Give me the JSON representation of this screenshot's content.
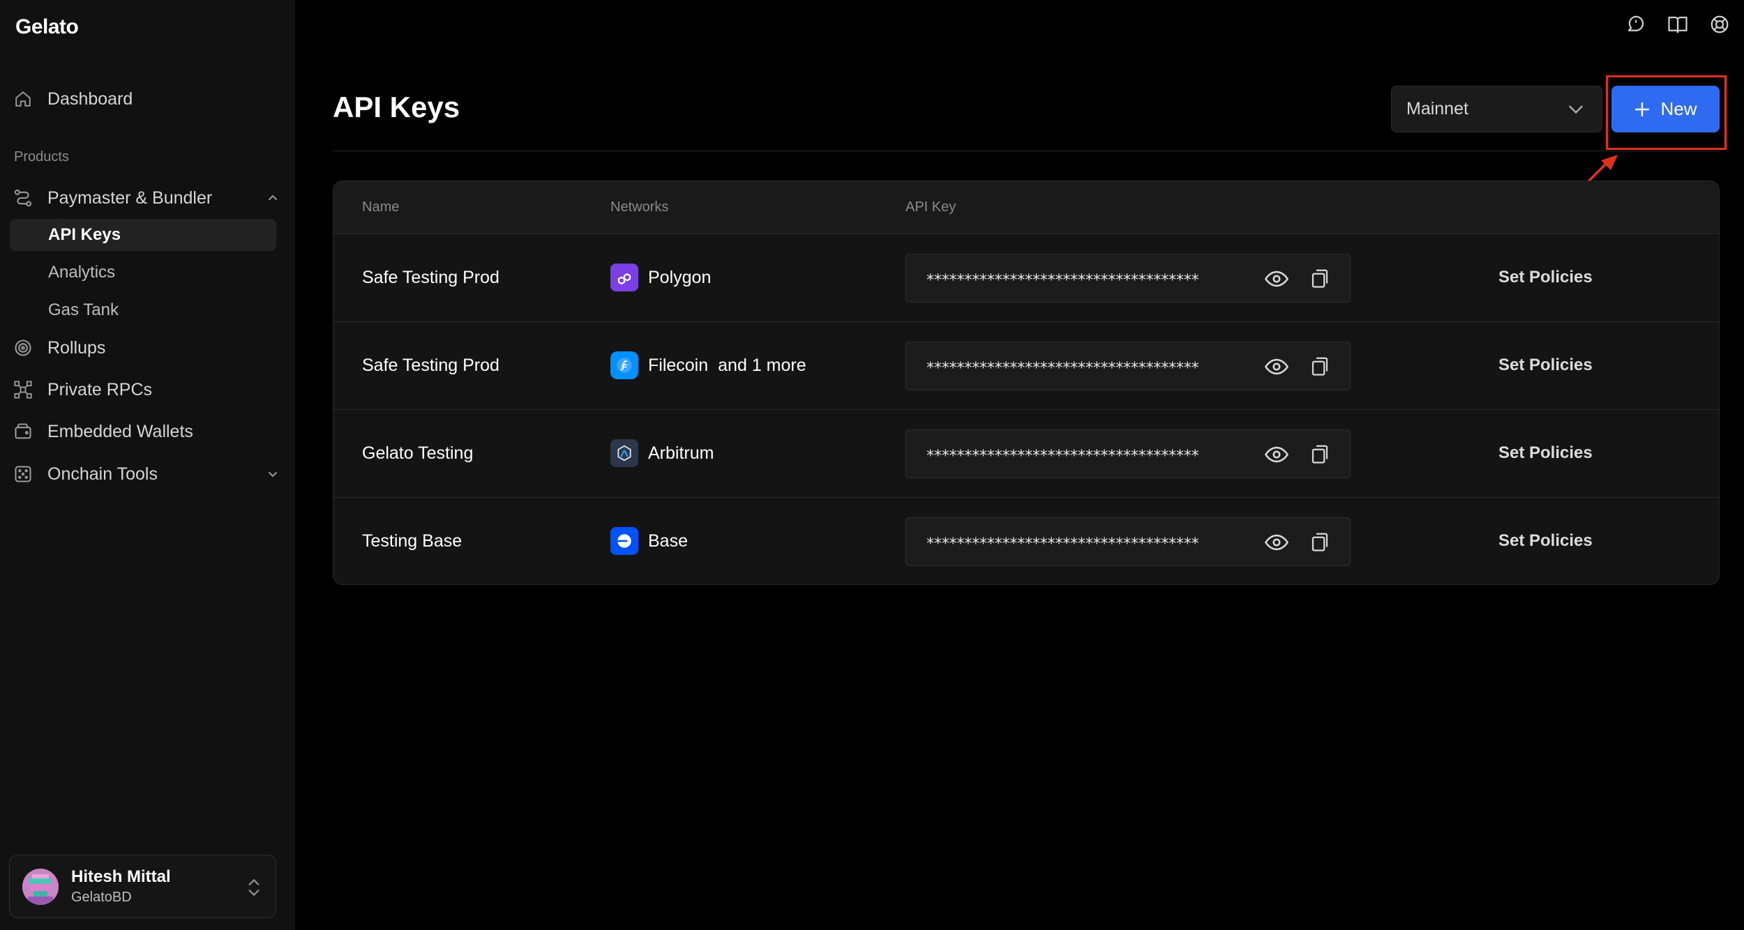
{
  "app": {
    "logo": "Gelato"
  },
  "sidebar": {
    "dashboard": "Dashboard",
    "section_title": "Products",
    "paymaster": "Paymaster & Bundler",
    "sub_items": [
      "API Keys",
      "Analytics",
      "Gas Tank"
    ],
    "rollups": "Rollups",
    "private_rpcs": "Private RPCs",
    "embedded_wallets": "Embedded Wallets",
    "onchain_tools": "Onchain Tools"
  },
  "user": {
    "name": "Hitesh Mittal",
    "org": "GelatoBD"
  },
  "header": {
    "title": "API Keys",
    "network_select": "Mainnet",
    "new_label": "New"
  },
  "table": {
    "columns": [
      "Name",
      "Networks",
      "API Key"
    ],
    "rows": [
      {
        "name": "Safe Testing Prod",
        "network": "Polygon",
        "more": "",
        "key": "************************************",
        "action": "Set Policies"
      },
      {
        "name": "Safe Testing Prod",
        "network": "Filecoin",
        "more": "and 1 more",
        "key": "************************************",
        "action": "Set Policies"
      },
      {
        "name": "Gelato Testing",
        "network": "Arbitrum",
        "more": "",
        "key": "************************************",
        "action": "Set Policies"
      },
      {
        "name": "Testing Base",
        "network": "Base",
        "more": "",
        "key": "************************************",
        "action": "Set Policies"
      }
    ]
  },
  "colors": {
    "accent": "#2f6bf0",
    "highlight": "#e0311f",
    "polygon": "#7b3fe4",
    "filecoin": "#0090ff",
    "arbitrum": "#2d374b",
    "base": "#0052ff"
  }
}
